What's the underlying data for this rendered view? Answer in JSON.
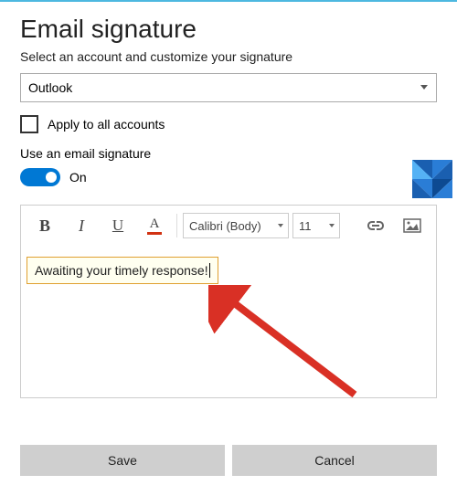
{
  "title": "Email signature",
  "subtitle": "Select an account and customize your signature",
  "account": {
    "selected": "Outlook"
  },
  "apply_all": {
    "label": "Apply to all accounts",
    "checked": false
  },
  "use_sig": {
    "label": "Use an email signature",
    "state_label": "On",
    "on": true
  },
  "toolbar": {
    "bold": "B",
    "italic": "I",
    "underline": "U",
    "fontcolor": "A",
    "font": "Calibri (Body)",
    "size": "11"
  },
  "signature_text": "Awaiting your timely response!",
  "buttons": {
    "save": "Save",
    "cancel": "Cancel"
  }
}
